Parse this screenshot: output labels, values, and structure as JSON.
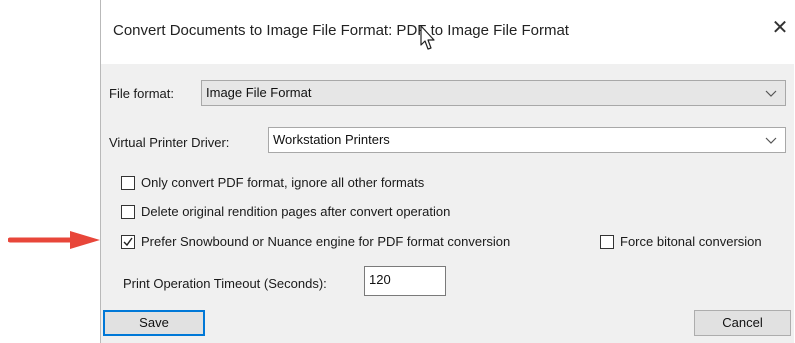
{
  "dialog": {
    "title": "Convert Documents to Image File Format: PDF to Image File Format",
    "close_glyph": "✕"
  },
  "form": {
    "file_format_label": "File format:",
    "file_format_value": "Image File Format",
    "printer_driver_label": "Virtual Printer Driver:",
    "printer_driver_value": "Workstation Printers",
    "timeout_label": "Print Operation Timeout (Seconds):",
    "timeout_value": "120"
  },
  "options": [
    {
      "label": "Only convert PDF format, ignore all other formats",
      "checked": false
    },
    {
      "label": "Delete original rendition pages after convert operation",
      "checked": false
    },
    {
      "label": "Prefer Snowbound or Nuance engine for PDF format conversion",
      "checked": true
    },
    {
      "label": "Force bitonal conversion",
      "checked": false
    }
  ],
  "buttons": {
    "save": "Save",
    "cancel": "Cancel"
  },
  "colors": {
    "annotation_arrow": "#e8463a",
    "default_button_border": "#0078d7"
  },
  "icons": {
    "close": "close-icon",
    "dropdown": "chevron-down-icon",
    "checkmark": "checkmark-icon",
    "cursor": "mouse-cursor-icon",
    "annotation": "red-arrow-icon"
  }
}
